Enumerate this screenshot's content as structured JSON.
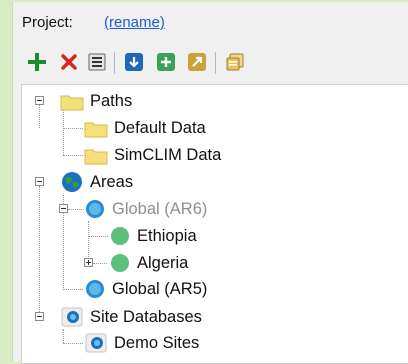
{
  "header": {
    "project_label": "Project:",
    "rename_link": "(rename)"
  },
  "toolbar": {
    "buttons": [
      {
        "name": "add-icon",
        "color": "#1e8a2e"
      },
      {
        "name": "delete-icon",
        "color": "#d9261c"
      },
      {
        "name": "list-icon",
        "color": "#4a4a4a"
      },
      {
        "name": "download-icon",
        "color": "#1f66b8"
      },
      {
        "name": "new-item-icon",
        "color": "#3aa35a"
      },
      {
        "name": "export-icon",
        "color": "#c9a23a"
      },
      {
        "name": "copy-icon",
        "color": "#c9a23a"
      }
    ]
  },
  "tree": {
    "paths": {
      "label": "Paths",
      "children": [
        "Default Data",
        "SimCLIM Data"
      ]
    },
    "areas": {
      "label": "Areas",
      "global_ar6": {
        "label": "Global (AR6)",
        "children": [
          "Ethiopia",
          "Algeria"
        ]
      },
      "global_ar5": "Global (AR5)"
    },
    "sites": {
      "label": "Site Databases",
      "children": [
        "Demo Sites"
      ]
    }
  },
  "colors": {
    "background": "#d9ecc4",
    "panel": "#f0f0f0",
    "link": "#1a5fd6",
    "folder": "#f4e07a",
    "region": "#5cbf7b"
  }
}
